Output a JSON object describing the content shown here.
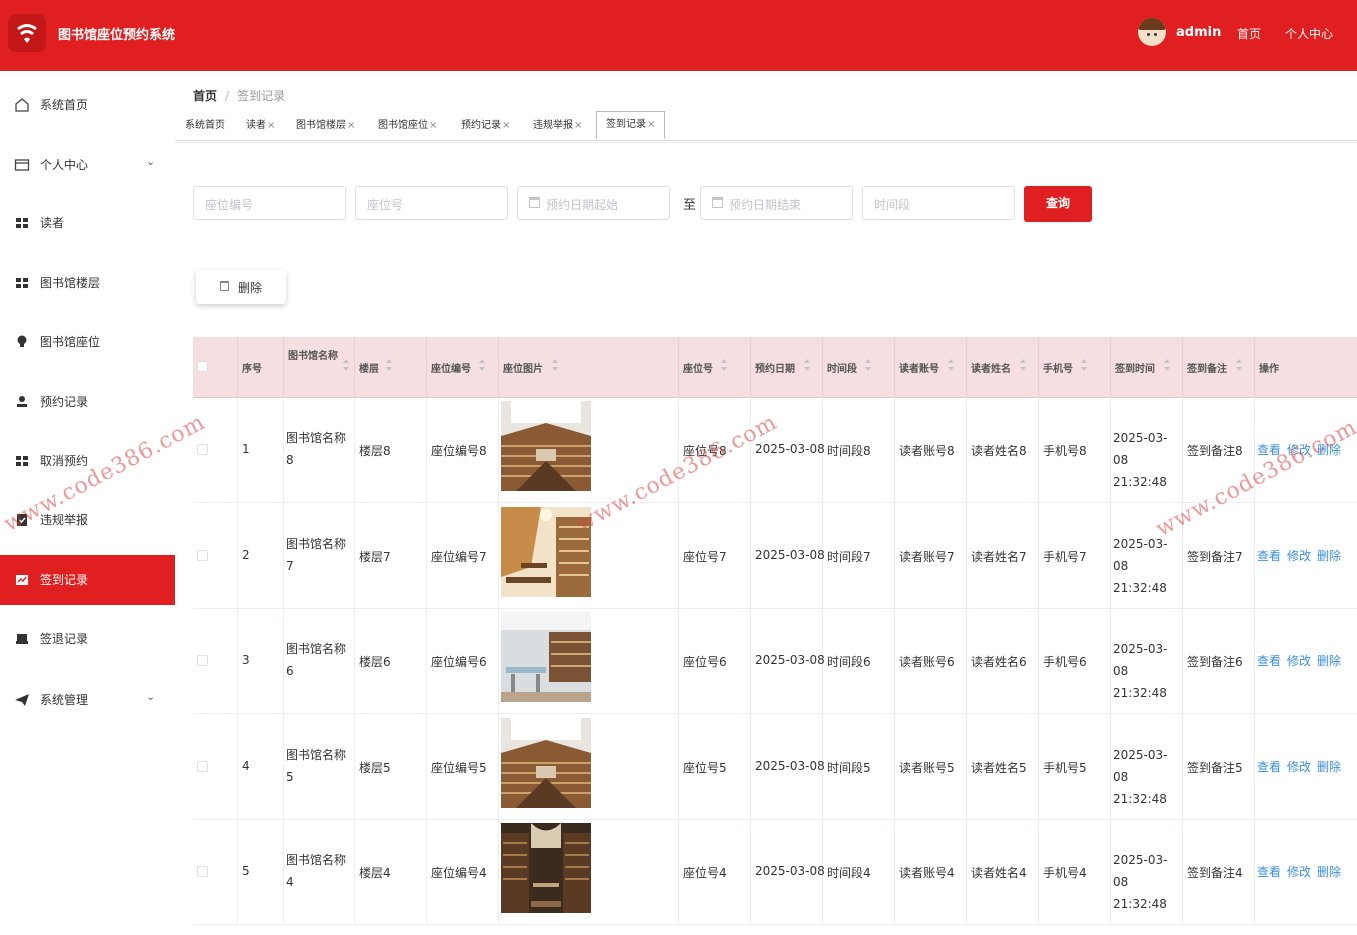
{
  "header": {
    "app_title": "图书馆座位预约系统",
    "user_name": "admin",
    "links": [
      "首页",
      "个人中心"
    ]
  },
  "sidebar": {
    "items": [
      {
        "label": "系统首页",
        "icon": "home-icon"
      },
      {
        "label": "个人中心",
        "icon": "profile-card-icon",
        "expandable": true
      },
      {
        "label": "读者",
        "icon": "grid-icon"
      },
      {
        "label": "图书馆楼层",
        "icon": "grid-icon"
      },
      {
        "label": "图书馆座位",
        "icon": "bulb-icon"
      },
      {
        "label": "预约记录",
        "icon": "user-icon"
      },
      {
        "label": "取消预约",
        "icon": "grid-icon"
      },
      {
        "label": "违规举报",
        "icon": "clipboard-check-icon"
      },
      {
        "label": "签到记录",
        "icon": "chart-icon",
        "active": true
      },
      {
        "label": "签退记录",
        "icon": "printer-icon"
      },
      {
        "label": "系统管理",
        "icon": "send-icon",
        "expandable": true
      }
    ]
  },
  "breadcrumb": {
    "home": "首页",
    "separator": "/",
    "current": "签到记录"
  },
  "tabs": [
    {
      "label": "系统首页",
      "closable": false
    },
    {
      "label": "读者",
      "closable": true
    },
    {
      "label": "图书馆楼层",
      "closable": true
    },
    {
      "label": "图书馆座位",
      "closable": true
    },
    {
      "label": "预约记录",
      "closable": true
    },
    {
      "label": "违规举报",
      "closable": true
    },
    {
      "label": "签到记录",
      "closable": true,
      "active": true
    }
  ],
  "tab_close_glyph": "×",
  "search": {
    "seat_code_placeholder": "座位编号",
    "seat_no_placeholder": "座位号",
    "date_start_placeholder": "预约日期起始",
    "to_label": "至",
    "date_end_placeholder": "预约日期结束",
    "time_slot_placeholder": "时间段",
    "query_label": "查询"
  },
  "toolbar": {
    "delete_label": "删除"
  },
  "table": {
    "headers": [
      "序号",
      "图书馆名称",
      "楼层",
      "座位编号",
      "座位图片",
      "座位号",
      "预约日期",
      "时间段",
      "读者账号",
      "读者姓名",
      "手机号",
      "签到时间",
      "签到备注",
      "操作"
    ],
    "rows": [
      {
        "index": "1",
        "library_name": "图书馆名称8",
        "floor": "楼层8",
        "seat_code": "座位编号8",
        "image": "library-atrium-photo",
        "seat_no": "座位号8",
        "date": "2025-03-08",
        "slot": "时间段8",
        "account": "读者账号8",
        "name": "读者姓名8",
        "phone": "手机号8",
        "checkin_date": "2025-03-08",
        "checkin_time": "21:32:48",
        "note": "签到备注8"
      },
      {
        "index": "2",
        "library_name": "图书馆名称7",
        "floor": "楼层7",
        "seat_code": "座位编号7",
        "image": "library-reading-room-photo",
        "seat_no": "座位号7",
        "date": "2025-03-08",
        "slot": "时间段7",
        "account": "读者账号7",
        "name": "读者姓名7",
        "phone": "手机号7",
        "checkin_date": "2025-03-08",
        "checkin_time": "21:32:48",
        "note": "签到备注7"
      },
      {
        "index": "3",
        "library_name": "图书馆名称6",
        "floor": "楼层6",
        "seat_code": "座位编号6",
        "image": "library-study-area-photo",
        "seat_no": "座位号6",
        "date": "2025-03-08",
        "slot": "时间段6",
        "account": "读者账号6",
        "name": "读者姓名6",
        "phone": "手机号6",
        "checkin_date": "2025-03-08",
        "checkin_time": "21:32:48",
        "note": "签到备注6"
      },
      {
        "index": "4",
        "library_name": "图书馆名称5",
        "floor": "楼层5",
        "seat_code": "座位编号5",
        "image": "library-atrium-photo",
        "seat_no": "座位号5",
        "date": "2025-03-08",
        "slot": "时间段5",
        "account": "读者账号5",
        "name": "读者姓名5",
        "phone": "手机号5",
        "checkin_date": "2025-03-08",
        "checkin_time": "21:32:48",
        "note": "签到备注5"
      },
      {
        "index": "5",
        "library_name": "图书馆名称4",
        "floor": "楼层4",
        "seat_code": "座位编号4",
        "image": "library-hall-photo",
        "seat_no": "座位号4",
        "date": "2025-03-08",
        "slot": "时间段4",
        "account": "读者账号4",
        "name": "读者姓名4",
        "phone": "手机号4",
        "checkin_date": "2025-03-08",
        "checkin_time": "21:32:48",
        "note": "签到备注4"
      }
    ],
    "actions": [
      "查看",
      "修改",
      "删除"
    ]
  },
  "watermark": "www.code386.com",
  "colors": {
    "primary": "#e02020",
    "header_row_bg": "#f6dfe1",
    "link": "#3c8fe0"
  }
}
